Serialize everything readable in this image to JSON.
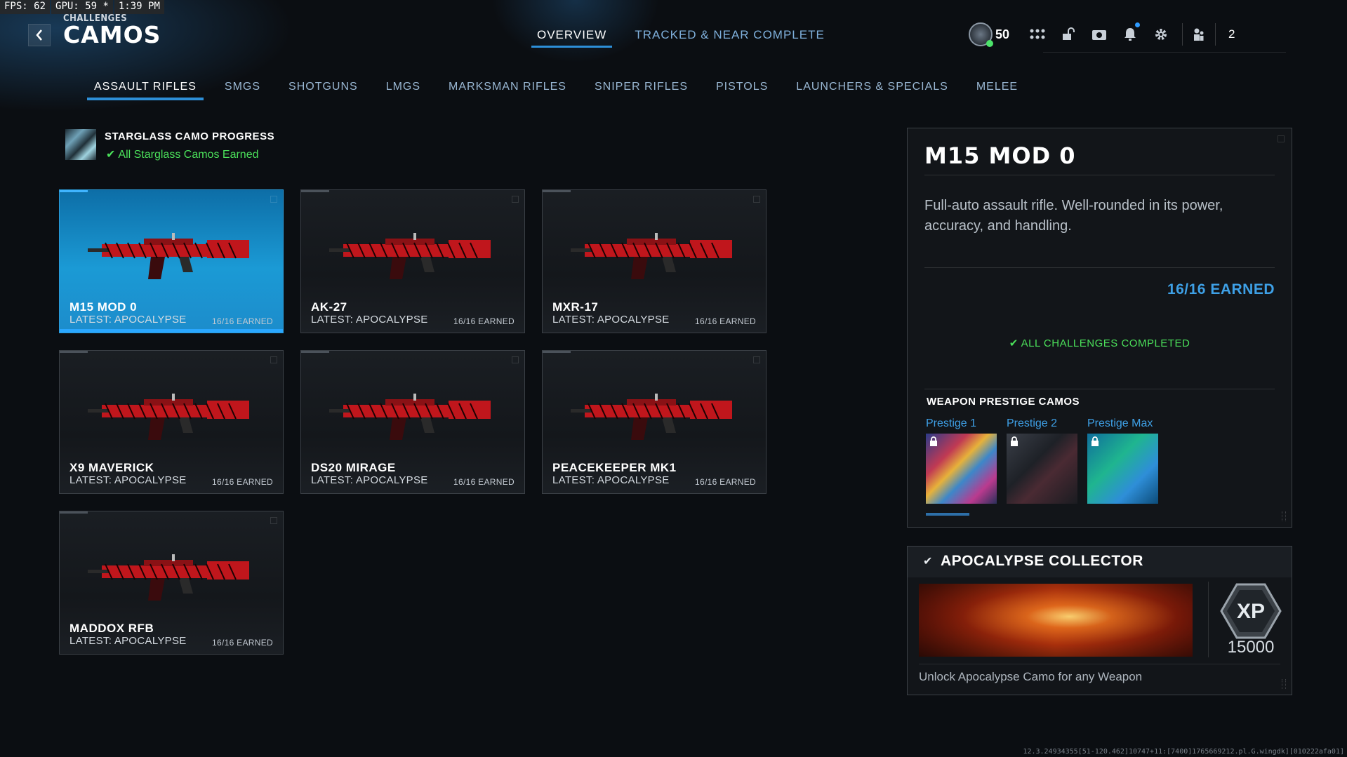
{
  "perf": {
    "fps": "FPS:  62",
    "gpu": "GPU: 59 *",
    "time": "1:39 PM"
  },
  "header": {
    "breadcrumb": "CHALLENGES",
    "title": "CAMOS",
    "back_icon": "chevron-left-icon",
    "tabs": [
      {
        "label": "OVERVIEW",
        "active": true
      },
      {
        "label": "TRACKED & NEAR COMPLETE",
        "active": false
      }
    ],
    "level": "50",
    "party_count": "2",
    "hud_icons": [
      "grid-icon",
      "unlock-icon",
      "camera-icon",
      "bell-icon",
      "gear-icon",
      "party-icon"
    ]
  },
  "categories": [
    {
      "label": "ASSAULT RIFLES",
      "active": true
    },
    {
      "label": "SMGS",
      "active": false
    },
    {
      "label": "SHOTGUNS",
      "active": false
    },
    {
      "label": "LMGS",
      "active": false
    },
    {
      "label": "MARKSMAN RIFLES",
      "active": false
    },
    {
      "label": "SNIPER RIFLES",
      "active": false
    },
    {
      "label": "PISTOLS",
      "active": false
    },
    {
      "label": "LAUNCHERS & SPECIALS",
      "active": false
    },
    {
      "label": "MELEE",
      "active": false
    }
  ],
  "starglass": {
    "title": "STARGLASS CAMO PROGRESS",
    "status": "All Starglass Camos Earned"
  },
  "weapons": [
    {
      "name": "M15 MOD 0",
      "latest": "LATEST: APOCALYPSE",
      "earned": "16/16 EARNED",
      "selected": true
    },
    {
      "name": "AK-27",
      "latest": "LATEST: APOCALYPSE",
      "earned": "16/16 EARNED",
      "selected": false
    },
    {
      "name": "MXR-17",
      "latest": "LATEST: APOCALYPSE",
      "earned": "16/16 EARNED",
      "selected": false
    },
    {
      "name": "X9 MAVERICK",
      "latest": "LATEST: APOCALYPSE",
      "earned": "16/16 EARNED",
      "selected": false
    },
    {
      "name": "DS20 MIRAGE",
      "latest": "LATEST: APOCALYPSE",
      "earned": "16/16 EARNED",
      "selected": false
    },
    {
      "name": "PEACEKEEPER MK1",
      "latest": "LATEST: APOCALYPSE",
      "earned": "16/16 EARNED",
      "selected": false
    },
    {
      "name": "MADDOX RFB",
      "latest": "LATEST: APOCALYPSE",
      "earned": "16/16 EARNED",
      "selected": false
    }
  ],
  "detail": {
    "title": "M15 MOD 0",
    "description": "Full-auto assault rifle. Well-rounded in its power, accuracy, and handling.",
    "earned": "16/16 EARNED",
    "status": "ALL CHALLENGES COMPLETED",
    "prestige_heading": "WEAPON PRESTIGE CAMOS",
    "prestige": [
      {
        "label": "Prestige 1",
        "locked": true
      },
      {
        "label": "Prestige 2",
        "locked": true
      },
      {
        "label": "Prestige Max",
        "locked": true
      }
    ]
  },
  "collector": {
    "title": "APOCALYPSE COLLECTOR",
    "xp_label": "XP",
    "xp_value": "15000",
    "description": "Unlock Apocalypse Camo for any Weapon"
  },
  "footer": {
    "build": "12.3.24934355[51-120.462]10747+11:[7400]1765669212.pl.G.wingdk][010222afa01]"
  },
  "colors": {
    "accent": "#2d8fd8",
    "selected_card": "#1b9ad5",
    "success": "#4be05a",
    "camo_red": "#c0161c"
  }
}
